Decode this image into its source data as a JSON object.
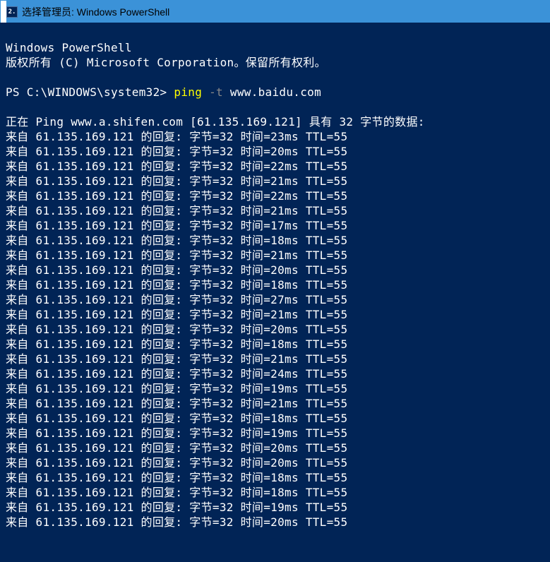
{
  "titlebar": {
    "icon_label": "2.",
    "title": "选择管理员: Windows PowerShell"
  },
  "header": {
    "line1": "Windows PowerShell",
    "line2": "版权所有 (C) Microsoft Corporation。保留所有权利。"
  },
  "prompt": {
    "path": "PS C:\\WINDOWS\\system32>",
    "cmd": "ping",
    "flag": "-t",
    "target": "www.baidu.com"
  },
  "ping_header": "正在 Ping www.a.shifen.com [61.135.169.121] 具有 32 字节的数据:",
  "ping_replies": [
    {
      "ip": "61.135.169.121",
      "bytes": 32,
      "time": 23,
      "ttl": 55
    },
    {
      "ip": "61.135.169.121",
      "bytes": 32,
      "time": 20,
      "ttl": 55
    },
    {
      "ip": "61.135.169.121",
      "bytes": 32,
      "time": 22,
      "ttl": 55
    },
    {
      "ip": "61.135.169.121",
      "bytes": 32,
      "time": 21,
      "ttl": 55
    },
    {
      "ip": "61.135.169.121",
      "bytes": 32,
      "time": 22,
      "ttl": 55
    },
    {
      "ip": "61.135.169.121",
      "bytes": 32,
      "time": 21,
      "ttl": 55
    },
    {
      "ip": "61.135.169.121",
      "bytes": 32,
      "time": 17,
      "ttl": 55
    },
    {
      "ip": "61.135.169.121",
      "bytes": 32,
      "time": 18,
      "ttl": 55
    },
    {
      "ip": "61.135.169.121",
      "bytes": 32,
      "time": 21,
      "ttl": 55
    },
    {
      "ip": "61.135.169.121",
      "bytes": 32,
      "time": 20,
      "ttl": 55
    },
    {
      "ip": "61.135.169.121",
      "bytes": 32,
      "time": 18,
      "ttl": 55
    },
    {
      "ip": "61.135.169.121",
      "bytes": 32,
      "time": 27,
      "ttl": 55
    },
    {
      "ip": "61.135.169.121",
      "bytes": 32,
      "time": 21,
      "ttl": 55
    },
    {
      "ip": "61.135.169.121",
      "bytes": 32,
      "time": 20,
      "ttl": 55
    },
    {
      "ip": "61.135.169.121",
      "bytes": 32,
      "time": 18,
      "ttl": 55
    },
    {
      "ip": "61.135.169.121",
      "bytes": 32,
      "time": 21,
      "ttl": 55
    },
    {
      "ip": "61.135.169.121",
      "bytes": 32,
      "time": 24,
      "ttl": 55
    },
    {
      "ip": "61.135.169.121",
      "bytes": 32,
      "time": 19,
      "ttl": 55
    },
    {
      "ip": "61.135.169.121",
      "bytes": 32,
      "time": 21,
      "ttl": 55
    },
    {
      "ip": "61.135.169.121",
      "bytes": 32,
      "time": 18,
      "ttl": 55
    },
    {
      "ip": "61.135.169.121",
      "bytes": 32,
      "time": 19,
      "ttl": 55
    },
    {
      "ip": "61.135.169.121",
      "bytes": 32,
      "time": 20,
      "ttl": 55
    },
    {
      "ip": "61.135.169.121",
      "bytes": 32,
      "time": 20,
      "ttl": 55
    },
    {
      "ip": "61.135.169.121",
      "bytes": 32,
      "time": 18,
      "ttl": 55
    },
    {
      "ip": "61.135.169.121",
      "bytes": 32,
      "time": 18,
      "ttl": 55
    },
    {
      "ip": "61.135.169.121",
      "bytes": 32,
      "time": 19,
      "ttl": 55
    },
    {
      "ip": "61.135.169.121",
      "bytes": 32,
      "time": 20,
      "ttl": 55
    }
  ],
  "reply_template": {
    "prefix": "来自 ",
    "reply_text": " 的回复: 字节=",
    "time_text": " 时间=",
    "time_unit": "ms ",
    "ttl_text": "TTL="
  }
}
